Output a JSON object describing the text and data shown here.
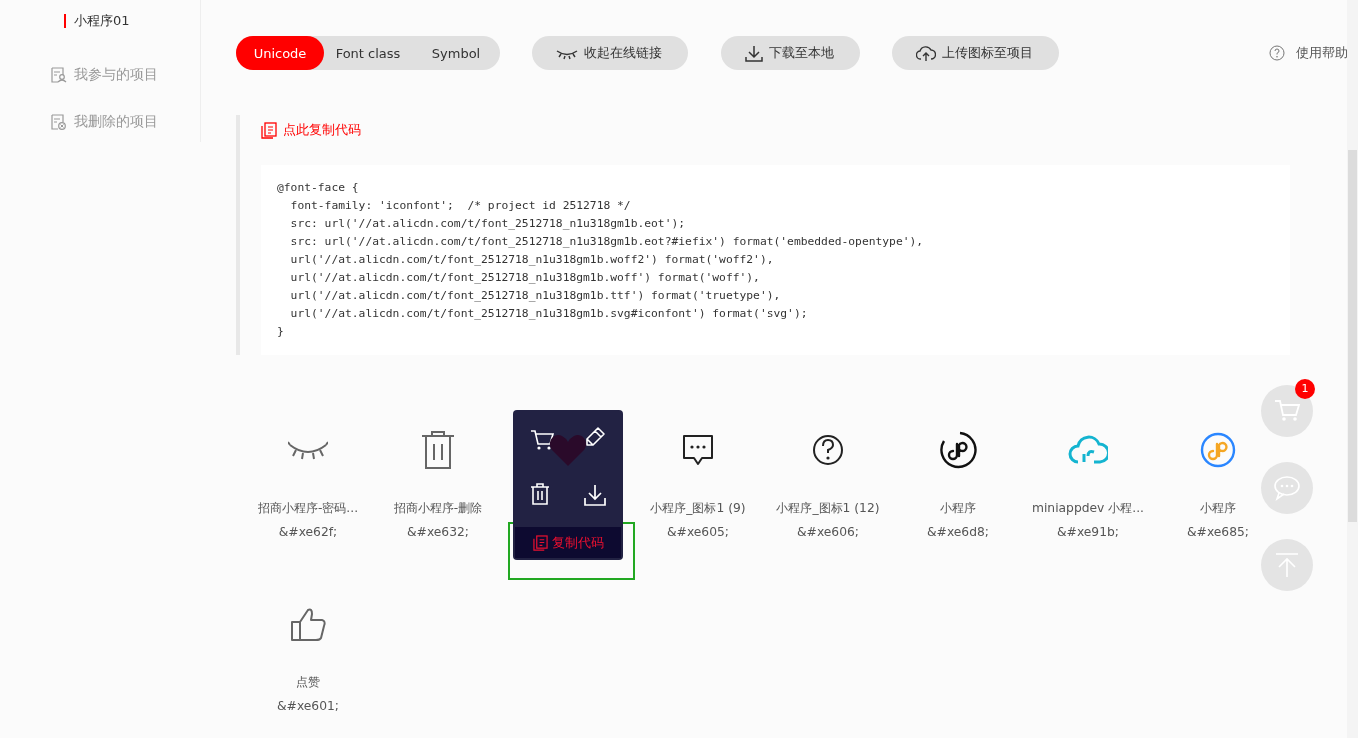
{
  "sidebar": {
    "items": [
      {
        "label": "小程序01",
        "selected": true
      },
      {
        "label": "我参与的项目",
        "selected": false
      },
      {
        "label": "我删除的项目",
        "selected": false
      }
    ]
  },
  "tabs": [
    {
      "label": "Unicode",
      "selected": true
    },
    {
      "label": "Font class",
      "selected": false
    },
    {
      "label": "Symbol",
      "selected": false
    }
  ],
  "actions": [
    {
      "label": "收起在线链接"
    },
    {
      "label": "下载至本地"
    },
    {
      "label": "上传图标至项目"
    }
  ],
  "help": {
    "label": "使用帮助"
  },
  "copy_link": {
    "label": "点此复制代码"
  },
  "code_lines": [
    "@font-face {",
    "  font-family: 'iconfont';  /* project id 2512718 */",
    "  src: url('//at.alicdn.com/t/font_2512718_n1u318gm1b.eot');",
    "  src: url('//at.alicdn.com/t/font_2512718_n1u318gm1b.eot?#iefix') format('embedded-opentype'),",
    "  url('//at.alicdn.com/t/font_2512718_n1u318gm1b.woff2') format('woff2'),",
    "  url('//at.alicdn.com/t/font_2512718_n1u318gm1b.woff') format('woff'),",
    "  url('//at.alicdn.com/t/font_2512718_n1u318gm1b.ttf') format('truetype'),",
    "  url('//at.alicdn.com/t/font_2512718_n1u318gm1b.svg#iconfont') format('svg');",
    "}"
  ],
  "icons": [
    {
      "kind": "eye-closed",
      "name": "招商小程序-密码...",
      "code": "&#xe62f;",
      "hovered": false
    },
    {
      "kind": "trash",
      "name": "招商小程序-删除",
      "code": "&#xe632;",
      "hovered": false
    },
    {
      "kind": "heart",
      "hovered": true
    },
    {
      "kind": "chat",
      "name": "小程序_图标1 (9)",
      "code": "&#xe605;",
      "hovered": false
    },
    {
      "kind": "question",
      "name": "小程序_图标1 (12)",
      "code": "&#xe606;",
      "hovered": false
    },
    {
      "kind": "miniapp",
      "name": "小程序",
      "code": "&#xe6d8;",
      "hovered": false
    },
    {
      "kind": "cloud",
      "name": "miniappdev 小程...",
      "code": "&#xe91b;",
      "hovered": false
    },
    {
      "kind": "miniapp-color",
      "name": "小程序",
      "code": "&#xe685;",
      "hovered": false
    },
    {
      "kind": "thumb",
      "name": "点赞",
      "code": "&#xe601;",
      "hovered": false
    }
  ],
  "hover_menu": {
    "copy_label": "复制代码"
  },
  "float_buttons": [
    {
      "kind": "cart",
      "badge": "1"
    },
    {
      "kind": "chat"
    },
    {
      "kind": "top"
    }
  ]
}
